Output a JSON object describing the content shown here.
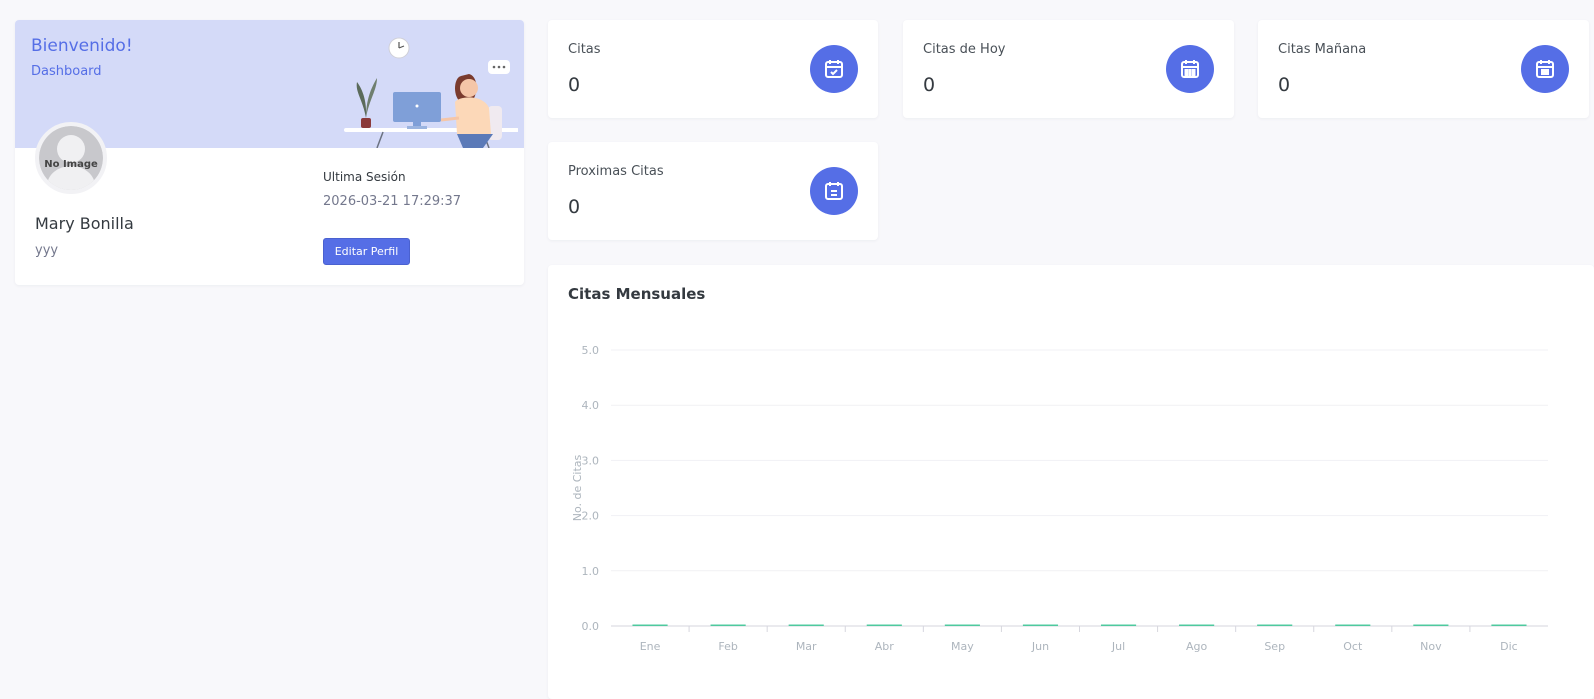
{
  "profile": {
    "welcome_title": "Bienvenido!",
    "welcome_subtitle": "Dashboard",
    "avatar_text": "No Image",
    "name": "Mary Bonilla",
    "role": "yyy",
    "session_label": "Ultima Sesión",
    "session_value": "2026-03-21 17:29:37",
    "edit_button": "Editar Perfil"
  },
  "stats": [
    {
      "label": "Citas",
      "value": "0",
      "icon": "calendar-check-icon"
    },
    {
      "label": "Citas de Hoy",
      "value": "0",
      "icon": "calendar-grid-icon"
    },
    {
      "label": "Citas Mañana",
      "value": "0",
      "icon": "calendar-day-icon"
    },
    {
      "label": "Proximas Citas",
      "value": "0",
      "icon": "calendar-list-icon"
    }
  ],
  "colors": {
    "accent": "#556ee6",
    "banner": "#d4daf8",
    "bar": "#34c38f"
  },
  "chart_data": {
    "type": "bar",
    "title": "Citas Mensuales",
    "xlabel": "",
    "ylabel": "No. de Citas",
    "categories": [
      "Ene",
      "Feb",
      "Mar",
      "Abr",
      "May",
      "Jun",
      "Jul",
      "Ago",
      "Sep",
      "Oct",
      "Nov",
      "Dic"
    ],
    "values": [
      0,
      0,
      0,
      0,
      0,
      0,
      0,
      0,
      0,
      0,
      0,
      0
    ],
    "ylim": [
      0,
      5
    ],
    "yticks": [
      "0.0",
      "1.0",
      "2.0",
      "3.0",
      "4.0",
      "5.0"
    ],
    "grid": true,
    "legend": "none"
  }
}
